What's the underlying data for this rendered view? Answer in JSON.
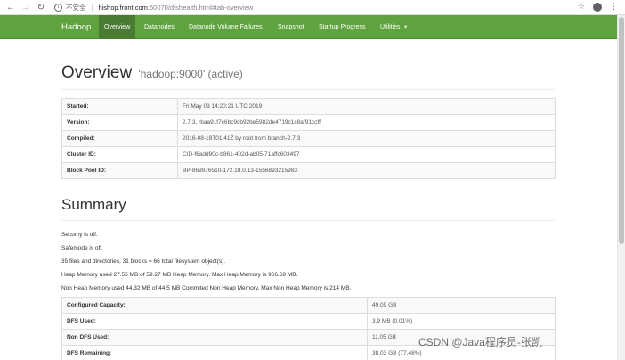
{
  "browser": {
    "not_secure": "不安全",
    "host": "hishop.front.com",
    "rest": ":50070/dfshealth.html#tab-overview"
  },
  "navbar": {
    "brand": "Hadoop",
    "items": [
      {
        "label": "Overview"
      },
      {
        "label": "Datanodes"
      },
      {
        "label": "Datanode Volume Failures"
      },
      {
        "label": "Snapshot"
      },
      {
        "label": "Startup Progress"
      },
      {
        "label": "Utilities"
      }
    ]
  },
  "overview": {
    "title": "Overview",
    "subtitle": "'hadoop:9000' (active)",
    "rows": [
      {
        "key": "Started:",
        "value": "Fri May 03 14:20:21 UTC 2019"
      },
      {
        "key": "Version:",
        "value": "2.7.3, rbaa91f7c6bc9cb92be5982de4719c1c8af91ccff"
      },
      {
        "key": "Compiled:",
        "value": "2016-08-18T01:41Z by root from branch-2.7.3"
      },
      {
        "key": "Cluster ID:",
        "value": "CID-f6add90c-b861-402d-ab05-71affc603497"
      },
      {
        "key": "Block Pool ID:",
        "value": "BP-869976510-172.18.0.13-1556893215983"
      }
    ]
  },
  "summary": {
    "title": "Summary",
    "lines": [
      "Security is off.",
      "Safemode is off.",
      "35 files and directories, 31 blocks = 66 total filesystem object(s).",
      "Heap Memory used 27.55 MB of 59.27 MB Heap Memory. Max Heap Memory is 966.69 MB.",
      "Non Heap Memory used 44.32 MB of 44.5 MB Commited Non Heap Memory. Max Non Heap Memory is 214 MB."
    ],
    "rows": [
      {
        "key": "Configured Capacity:",
        "value": "49.09 GB"
      },
      {
        "key": "DFS Used:",
        "value": "3.9 MB (0.01%)"
      },
      {
        "key": "Non DFS Used:",
        "value": "11.05 GB"
      },
      {
        "key": "DFS Remaining:",
        "value": "38.03 GB (77.48%)"
      }
    ]
  },
  "watermark": "CSDN @Java程序员-张凯"
}
